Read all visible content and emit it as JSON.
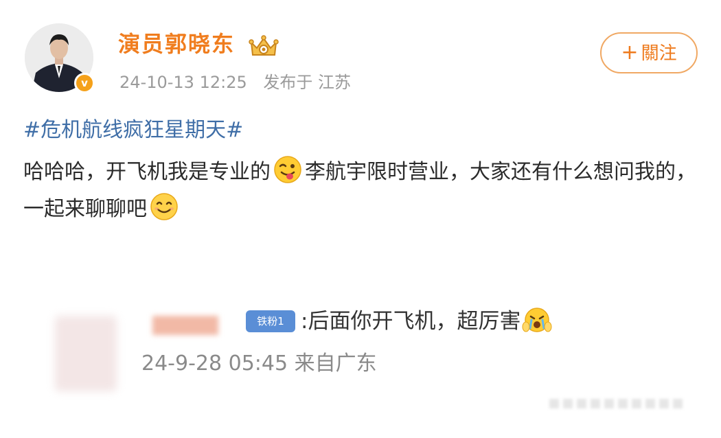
{
  "header": {
    "username": "演员郭晓东",
    "timestamp": "24-10-13 12:25",
    "location": "发布于 江苏",
    "follow_label": "關注",
    "follow_plus": "+",
    "verify_mark": "v"
  },
  "post": {
    "hashtag": "#危机航线疯狂星期天#",
    "text_part1": "哈哈哈，开飞机我是专业的",
    "text_part2": "李航宇限时营业，大家还有什么想问我的，一起来聊聊吧",
    "emoji1": "wink-tongue-emoji",
    "emoji2": "smile-emoji"
  },
  "embedded_comment": {
    "fan_badge": "铁粉1",
    "comment": ":后面你开飞机，超厉害",
    "comment_emoji": "crying-clap-emoji",
    "timestamp": "24-9-28 05:45",
    "source": "来自广东"
  },
  "colors": {
    "username": "#f07d1e",
    "hashtag": "#3f6ea7",
    "follow_border": "#f0a863",
    "verify_badge": "#f5a11a",
    "fan_badge": "#5a8ed6"
  }
}
